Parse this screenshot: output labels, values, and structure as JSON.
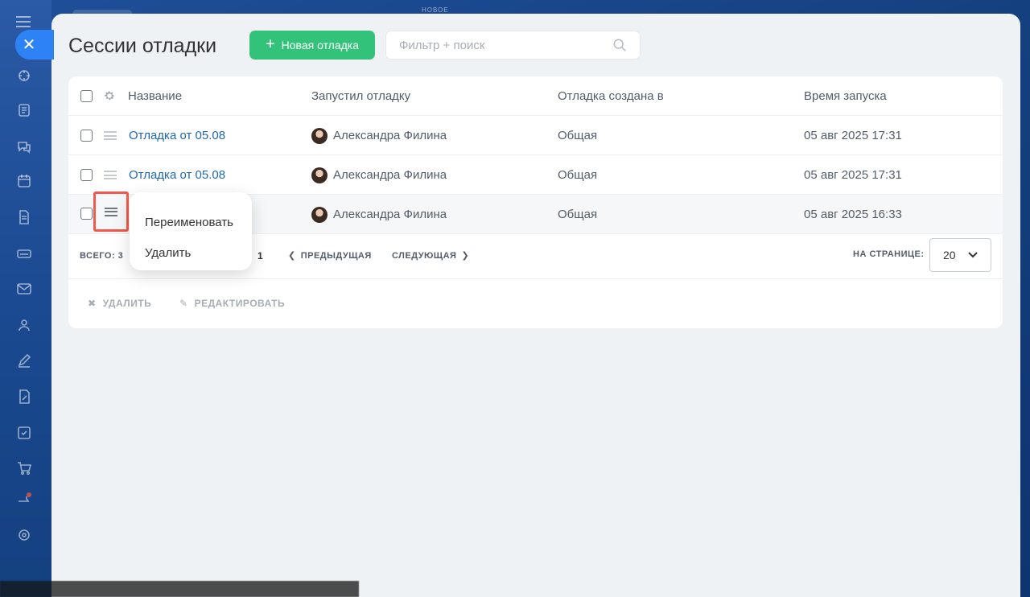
{
  "top": {
    "label": "НОВОЕ"
  },
  "page": {
    "title": "Сессии отладки"
  },
  "toolbar": {
    "new_button": "Новая отладка",
    "search_placeholder": "Фильтр + поиск"
  },
  "table": {
    "columns": [
      "Название",
      "Запустил отладку",
      "Отладка создана в",
      "Время запуска"
    ],
    "rows": [
      {
        "name": "Отладка от 05.08",
        "user": "Александра Филина",
        "created_in": "Общая",
        "time": "05 авг 2025 17:31"
      },
      {
        "name": "Отладка от 05.08",
        "user": "Александра Филина",
        "created_in": "Общая",
        "time": "05 авг 2025 17:31"
      },
      {
        "name": "",
        "user": "Александра Филина",
        "created_in": "Общая",
        "time": "05 авг 2025 16:33"
      }
    ]
  },
  "context_menu": {
    "items": [
      "Переименовать",
      "Удалить"
    ]
  },
  "pagination": {
    "total_label": "ВСЕГО: 3",
    "current_page": "1",
    "prev": "ПРЕДЫДУЩАЯ",
    "next": "СЛЕДУЮЩАЯ",
    "per_page_label": "НА СТРАНИЦЕ:",
    "per_page_value": "20"
  },
  "actions": {
    "delete": "УДАЛИТЬ",
    "edit": "РЕДАКТИРОВАТЬ"
  },
  "colors": {
    "accent_green": "#33c27a",
    "link_blue": "#2067b0",
    "highlight_red": "#f0594b",
    "close_blue": "#2d82f5"
  }
}
